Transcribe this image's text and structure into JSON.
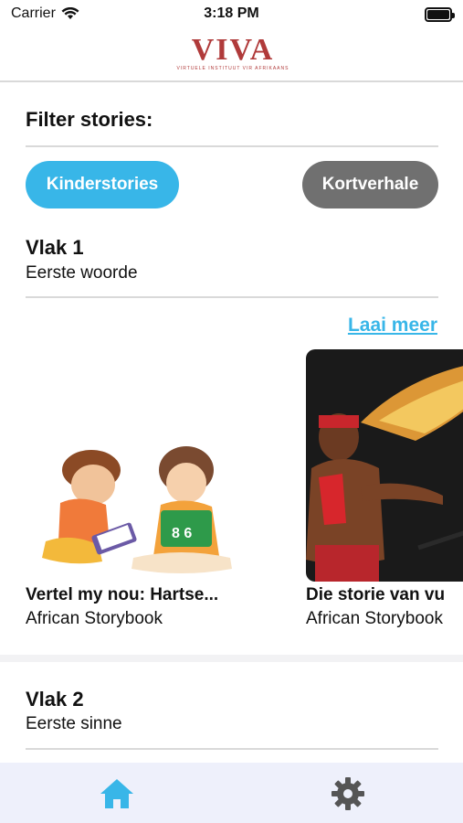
{
  "status": {
    "carrier": "Carrier",
    "time": "3:18 PM"
  },
  "header": {
    "logo_text": "VIVA",
    "logo_tagline": "VIRTUELE INSTITUUT VIR AFRIKAANS"
  },
  "filter": {
    "title": "Filter stories:",
    "options": [
      {
        "label": "Kinderstories",
        "active": true
      },
      {
        "label": "Kortverhale",
        "active": false
      }
    ]
  },
  "sections": [
    {
      "title": "Vlak 1",
      "subtitle": "Eerste woorde",
      "load_more": "Laai meer",
      "stories": [
        {
          "title": "Vertel my nou: Hartse...",
          "author": "African Storybook"
        },
        {
          "title": "Die storie van vu",
          "author": "African Storybook"
        }
      ]
    },
    {
      "title": "Vlak 2",
      "subtitle": "Eerste sinne"
    }
  ],
  "tabbar": {
    "items": [
      {
        "icon": "home-icon",
        "active": true
      },
      {
        "icon": "gear-icon",
        "active": false
      }
    ],
    "active_color": "#38b6e8",
    "inactive_color": "#555555"
  },
  "colors": {
    "accent": "#38b6e8",
    "chip_inactive": "#707070",
    "logo": "#b03a3a"
  }
}
